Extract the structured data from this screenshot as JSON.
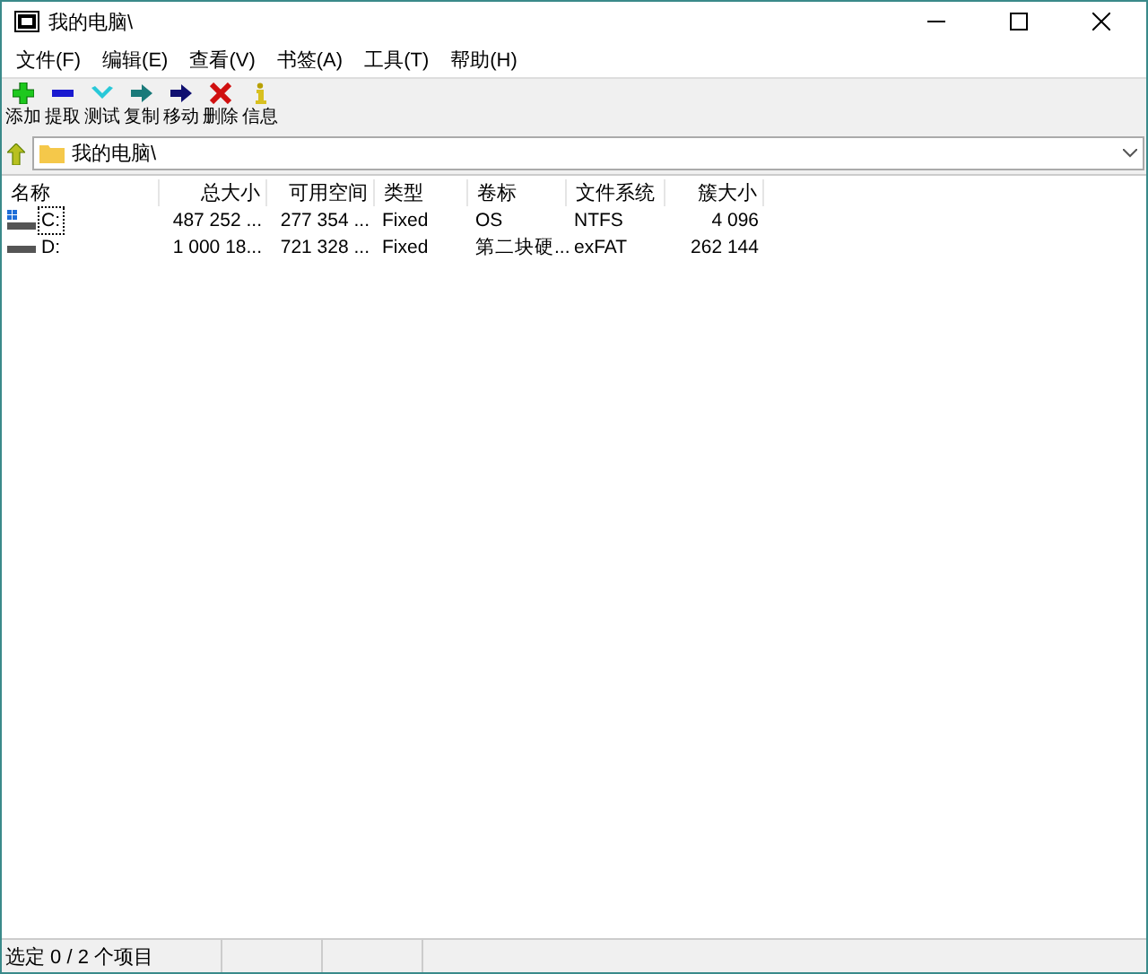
{
  "window": {
    "title": "我的电脑\\"
  },
  "menu": [
    "文件(F)",
    "编辑(E)",
    "查看(V)",
    "书签(A)",
    "工具(T)",
    "帮助(H)"
  ],
  "toolbar": [
    {
      "kind": "add",
      "label": "添加"
    },
    {
      "kind": "extract",
      "label": "提取"
    },
    {
      "kind": "test",
      "label": "测试"
    },
    {
      "kind": "copy",
      "label": "复制"
    },
    {
      "kind": "move",
      "label": "移动"
    },
    {
      "kind": "delete",
      "label": "删除"
    },
    {
      "kind": "info",
      "label": "信息"
    }
  ],
  "address": {
    "value": "我的电脑\\"
  },
  "table": {
    "columns": [
      "名称",
      "总大小",
      "可用空间",
      "类型",
      "卷标",
      "文件系统",
      "簇大小"
    ],
    "rows": [
      {
        "kind": "system",
        "focused": true,
        "cells": [
          "C:",
          "487 252 ...",
          "277 354 ...",
          "Fixed",
          "OS",
          "NTFS",
          "4 096"
        ]
      },
      {
        "kind": "disk",
        "focused": false,
        "cells": [
          "D:",
          "1 000 18...",
          "721 328 ...",
          "Fixed",
          "第二块硬...",
          "exFAT",
          "262 144"
        ]
      }
    ]
  },
  "status_bar": "选定 0 / 2 个项目"
}
